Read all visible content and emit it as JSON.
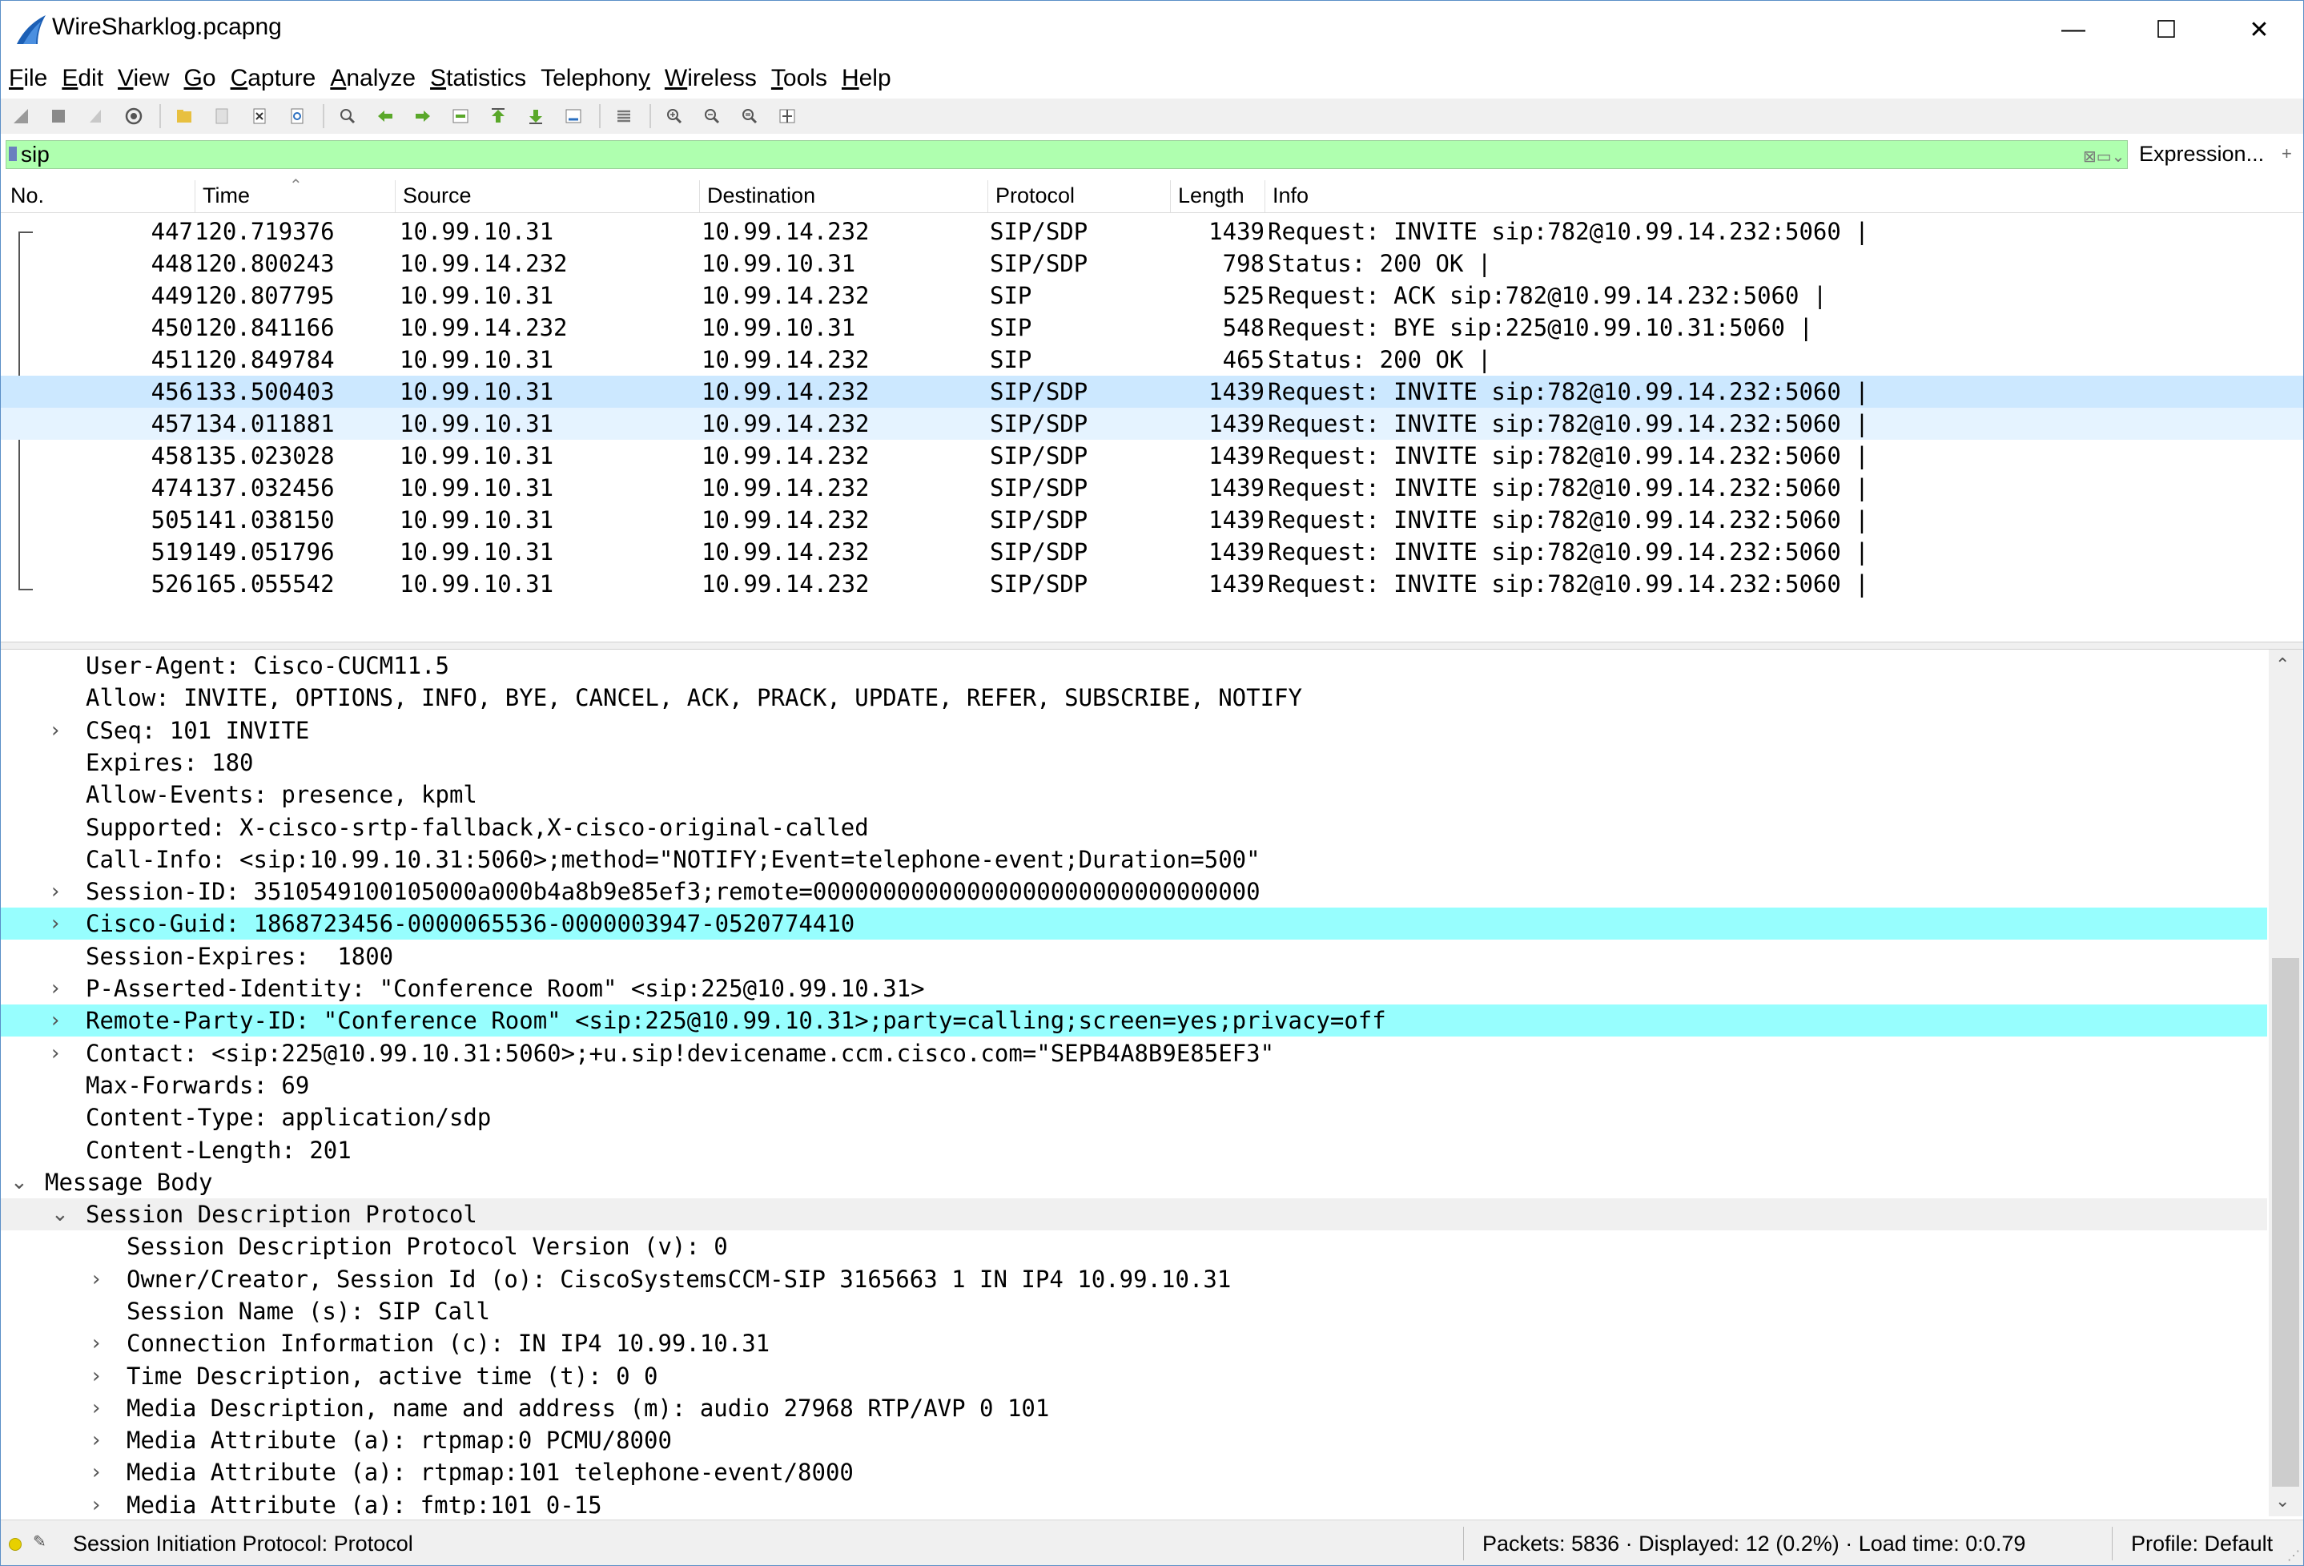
{
  "window": {
    "title": "WireSharklog.pcapng",
    "minimize": "—",
    "maximize": "☐",
    "close": "✕"
  },
  "menu": [
    {
      "label": "File",
      "mnemonic": "F",
      "rest": "ile"
    },
    {
      "label": "Edit",
      "mnemonic": "E",
      "rest": "dit"
    },
    {
      "label": "View",
      "mnemonic": "V",
      "rest": "iew"
    },
    {
      "label": "Go",
      "mnemonic": "G",
      "rest": "o"
    },
    {
      "label": "Capture",
      "mnemonic": "C",
      "rest": "apture"
    },
    {
      "label": "Analyze",
      "mnemonic": "A",
      "rest": "nalyze"
    },
    {
      "label": "Statistics",
      "mnemonic": "S",
      "rest": "tatistics"
    },
    {
      "label": "Telephony",
      "mnemonic": "y",
      "rest": "Telephon"
    },
    {
      "label": "Wireless",
      "mnemonic": "W",
      "rest": "ireless"
    },
    {
      "label": "Tools",
      "mnemonic": "T",
      "rest": "ools"
    },
    {
      "label": "Help",
      "mnemonic": "H",
      "rest": "elp"
    }
  ],
  "filter": {
    "value": "sip",
    "expression_label": "Expression...",
    "plus": "+"
  },
  "columns": {
    "no": "No.",
    "time": "Time",
    "source": "Source",
    "destination": "Destination",
    "protocol": "Protocol",
    "length": "Length",
    "info": "Info"
  },
  "packets": [
    {
      "no": "447",
      "time": "120.719376",
      "src": "10.99.10.31",
      "dst": "10.99.14.232",
      "proto": "SIP/SDP",
      "len": "1439",
      "info": "Request: INVITE sip:782@10.99.14.232:5060 |"
    },
    {
      "no": "448",
      "time": "120.800243",
      "src": "10.99.14.232",
      "dst": "10.99.10.31",
      "proto": "SIP/SDP",
      "len": "798",
      "info": "Status: 200 OK |"
    },
    {
      "no": "449",
      "time": "120.807795",
      "src": "10.99.10.31",
      "dst": "10.99.14.232",
      "proto": "SIP",
      "len": "525",
      "info": "Request: ACK sip:782@10.99.14.232:5060 |"
    },
    {
      "no": "450",
      "time": "120.841166",
      "src": "10.99.14.232",
      "dst": "10.99.10.31",
      "proto": "SIP",
      "len": "548",
      "info": "Request: BYE sip:225@10.99.10.31:5060 |"
    },
    {
      "no": "451",
      "time": "120.849784",
      "src": "10.99.10.31",
      "dst": "10.99.14.232",
      "proto": "SIP",
      "len": "465",
      "info": "Status: 200 OK |"
    },
    {
      "no": "456",
      "time": "133.500403",
      "src": "10.99.10.31",
      "dst": "10.99.14.232",
      "proto": "SIP/SDP",
      "len": "1439",
      "info": "Request: INVITE sip:782@10.99.14.232:5060 |"
    },
    {
      "no": "457",
      "time": "134.011881",
      "src": "10.99.10.31",
      "dst": "10.99.14.232",
      "proto": "SIP/SDP",
      "len": "1439",
      "info": "Request: INVITE sip:782@10.99.14.232:5060 |"
    },
    {
      "no": "458",
      "time": "135.023028",
      "src": "10.99.10.31",
      "dst": "10.99.14.232",
      "proto": "SIP/SDP",
      "len": "1439",
      "info": "Request: INVITE sip:782@10.99.14.232:5060 |"
    },
    {
      "no": "474",
      "time": "137.032456",
      "src": "10.99.10.31",
      "dst": "10.99.14.232",
      "proto": "SIP/SDP",
      "len": "1439",
      "info": "Request: INVITE sip:782@10.99.14.232:5060 |"
    },
    {
      "no": "505",
      "time": "141.038150",
      "src": "10.99.10.31",
      "dst": "10.99.14.232",
      "proto": "SIP/SDP",
      "len": "1439",
      "info": "Request: INVITE sip:782@10.99.14.232:5060 |"
    },
    {
      "no": "519",
      "time": "149.051796",
      "src": "10.99.10.31",
      "dst": "10.99.14.232",
      "proto": "SIP/SDP",
      "len": "1439",
      "info": "Request: INVITE sip:782@10.99.14.232:5060 |"
    },
    {
      "no": "526",
      "time": "165.055542",
      "src": "10.99.10.31",
      "dst": "10.99.14.232",
      "proto": "SIP/SDP",
      "len": "1439",
      "info": "Request: INVITE sip:782@10.99.14.232:5060 |"
    }
  ],
  "details": [
    {
      "text": "User-Agent: Cisco-CUCM11.5",
      "indent": 2,
      "arrow": "",
      "style": ""
    },
    {
      "text": "Allow: INVITE, OPTIONS, INFO, BYE, CANCEL, ACK, PRACK, UPDATE, REFER, SUBSCRIBE, NOTIFY",
      "indent": 2,
      "arrow": "",
      "style": ""
    },
    {
      "text": "CSeq: 101 INVITE",
      "indent": 2,
      "arrow": "›",
      "style": ""
    },
    {
      "text": "Expires: 180",
      "indent": 2,
      "arrow": "",
      "style": ""
    },
    {
      "text": "Allow-Events: presence, kpml",
      "indent": 2,
      "arrow": "",
      "style": ""
    },
    {
      "text": "Supported: X-cisco-srtp-fallback,X-cisco-original-called",
      "indent": 2,
      "arrow": "",
      "style": ""
    },
    {
      "text": "Call-Info: <sip:10.99.10.31:5060>;method=\"NOTIFY;Event=telephone-event;Duration=500\"",
      "indent": 2,
      "arrow": "",
      "style": ""
    },
    {
      "text": "Session-ID: 3510549100105000a000b4a8b9e85ef3;remote=00000000000000000000000000000000",
      "indent": 2,
      "arrow": "›",
      "style": ""
    },
    {
      "text": "Cisco-Guid: 1868723456-0000065536-0000003947-0520774410",
      "indent": 2,
      "arrow": "›",
      "style": "hl"
    },
    {
      "text": "Session-Expires:  1800",
      "indent": 2,
      "arrow": "",
      "style": ""
    },
    {
      "text": "P-Asserted-Identity: \"Conference Room\" <sip:225@10.99.10.31>",
      "indent": 2,
      "arrow": "›",
      "style": ""
    },
    {
      "text": "Remote-Party-ID: \"Conference Room\" <sip:225@10.99.10.31>;party=calling;screen=yes;privacy=off",
      "indent": 2,
      "arrow": "›",
      "style": "hl"
    },
    {
      "text": "Contact: <sip:225@10.99.10.31:5060>;+u.sip!devicename.ccm.cisco.com=\"SEPB4A8B9E85EF3\"",
      "indent": 2,
      "arrow": "›",
      "style": ""
    },
    {
      "text": "Max-Forwards: 69",
      "indent": 2,
      "arrow": "",
      "style": ""
    },
    {
      "text": "Content-Type: application/sdp",
      "indent": 2,
      "arrow": "",
      "style": ""
    },
    {
      "text": "Content-Length: 201",
      "indent": 2,
      "arrow": "",
      "style": ""
    },
    {
      "text": "Message Body",
      "indent": 1,
      "arrow": "⌄",
      "style": ""
    },
    {
      "text": "Session Description Protocol",
      "indent": 2,
      "arrow": "⌄",
      "style": "sub"
    },
    {
      "text": "Session Description Protocol Version (v): 0",
      "indent": 3,
      "arrow": "",
      "style": ""
    },
    {
      "text": "Owner/Creator, Session Id (o): CiscoSystemsCCM-SIP 3165663 1 IN IP4 10.99.10.31",
      "indent": 3,
      "arrow": "›",
      "style": ""
    },
    {
      "text": "Session Name (s): SIP Call",
      "indent": 3,
      "arrow": "",
      "style": ""
    },
    {
      "text": "Connection Information (c): IN IP4 10.99.10.31",
      "indent": 3,
      "arrow": "›",
      "style": ""
    },
    {
      "text": "Time Description, active time (t): 0 0",
      "indent": 3,
      "arrow": "›",
      "style": ""
    },
    {
      "text": "Media Description, name and address (m): audio 27968 RTP/AVP 0 101",
      "indent": 3,
      "arrow": "›",
      "style": ""
    },
    {
      "text": "Media Attribute (a): rtpmap:0 PCMU/8000",
      "indent": 3,
      "arrow": "›",
      "style": ""
    },
    {
      "text": "Media Attribute (a): rtpmap:101 telephone-event/8000",
      "indent": 3,
      "arrow": "›",
      "style": ""
    },
    {
      "text": "Media Attribute (a): fmtp:101 0-15",
      "indent": 3,
      "arrow": "›",
      "style": ""
    }
  ],
  "status": {
    "text": "Session Initiation Protocol: Protocol",
    "packets": "Packets: 5836 · Displayed: 12 (0.2%) · Load time: 0:0.79",
    "profile": "Profile: Default"
  },
  "colors": {
    "filter_ok": "#afffaf",
    "selected_row": "#cce8ff",
    "highlight_field": "#97fefe",
    "app_icon": "#1c5fb5"
  }
}
